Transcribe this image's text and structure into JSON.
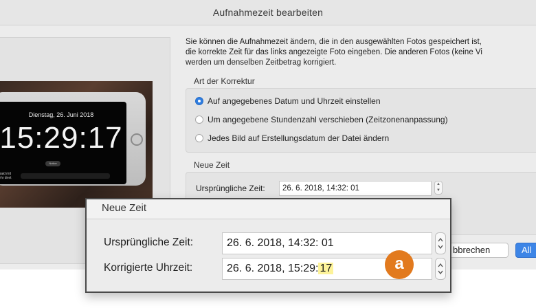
{
  "window": {
    "title": "Aufnahmezeit bearbeiten"
  },
  "intro_lines": [
    "Sie können die Aufnahmezeit ändern, die in den ausgewählten Fotos gespeichert ist,",
    "die korrekte Zeit für das links angezeigte Foto eingeben. Die anderen Fotos (keine Vi",
    "werden um denselben Zeitbetrag korrigiert."
  ],
  "correction": {
    "label": "Art der Korrektur",
    "options": [
      {
        "label": "Auf angegebenes Datum und Uhrzeit einstellen",
        "selected": true
      },
      {
        "label": "Um angegebene Stundenzahl verschieben (Zeitzonenanpassung)",
        "selected": false
      },
      {
        "label": "Jedes Bild auf Erstellungsdatum der Datei ändern",
        "selected": false
      }
    ]
  },
  "new_time": {
    "label": "Neue Zeit",
    "original_label": "Ursprüngliche Zeit:",
    "original_value": "26. 6. 2018, 14:32: 01"
  },
  "preview": {
    "date": "Dienstag, 26. Juni 2018",
    "time": "15:29:17",
    "pill": "Notice",
    "note": "repaid mit mehr dnet"
  },
  "buttons": {
    "cancel": "bbrechen",
    "primary": "All"
  },
  "callout": {
    "title": "Neue Zeit",
    "original_label": "Ursprüngliche Zeit:",
    "original_value": "26. 6. 2018, 14:32: 01",
    "corrected_label": "Korrigierte Uhrzeit:",
    "corrected_value_prefix": "26. 6. 2018, 15:29:",
    "corrected_value_seconds": "17",
    "badge": "a"
  },
  "colors": {
    "accent": "#3d85e6",
    "badge": "#e27a1e",
    "highlight": "#fdf39a"
  }
}
